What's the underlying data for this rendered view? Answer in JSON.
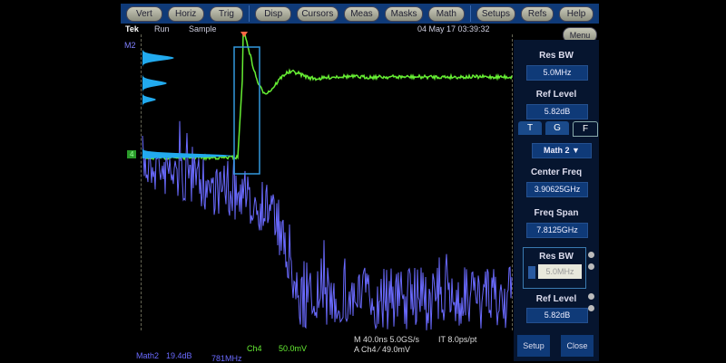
{
  "menu": [
    "Vert",
    "Horiz",
    "Trig",
    "Disp",
    "Cursors",
    "Meas",
    "Masks",
    "Math",
    "Setups",
    "Refs",
    "Help"
  ],
  "status": {
    "brand": "Tek",
    "state": "Run",
    "mode": "Sample",
    "datetime": "04 May 17 03:39:32",
    "menu_button": "Menu"
  },
  "markers": {
    "math": "M2",
    "ch4": "4"
  },
  "panel": {
    "res_bw_label": "Res BW",
    "res_bw": "5.0MHz",
    "ref_level_label": "Ref Level",
    "ref_level": "5.82dB",
    "tabs": [
      "T",
      "G",
      "F"
    ],
    "source": "Math 2 ▼",
    "center_freq_label": "Center Freq",
    "center_freq": "3.90625GHz",
    "freq_span_label": "Freq Span",
    "freq_span": "7.8125GHz",
    "res_bw2_label": "Res BW",
    "res_bw2": "5.0MHz",
    "ref_level2_label": "Ref Level",
    "ref_level2": "5.82dB",
    "setup": "Setup",
    "close": "Close"
  },
  "readout": {
    "math_label": "Math2",
    "math_scale": "19.4dB",
    "math_freq": "781MHz",
    "ch_label": "Ch4",
    "ch_scale": "50.0mV",
    "timebase": "M 40.0ns 5.0GS/s",
    "it": "IT 8.0ps/pt",
    "trigger": "A  Ch4  ⁄  49.0mV"
  },
  "colors": {
    "ch4": "#66ee33",
    "math": "#6a6aff",
    "histogram": "#22aaee",
    "zoom_box": "#3399dd"
  }
}
